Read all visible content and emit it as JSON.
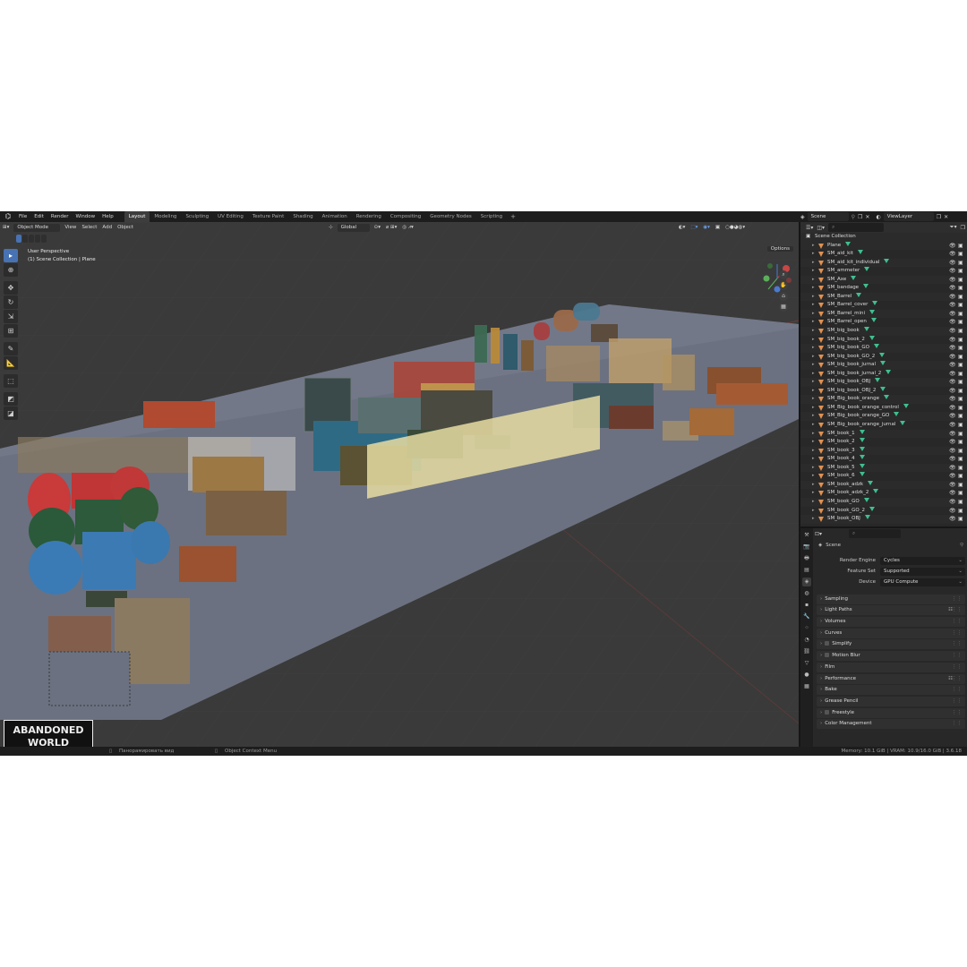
{
  "topbar": {
    "menus": [
      "File",
      "Edit",
      "Render",
      "Window",
      "Help"
    ],
    "workspaces": [
      "Layout",
      "Modeling",
      "Sculpting",
      "UV Editing",
      "Texture Paint",
      "Shading",
      "Animation",
      "Rendering",
      "Compositing",
      "Geometry Nodes",
      "Scripting"
    ],
    "active_workspace": "Layout",
    "scene": "Scene",
    "view_layer": "ViewLayer"
  },
  "viewport": {
    "mode": "Object Mode",
    "menus": [
      "View",
      "Select",
      "Add",
      "Object"
    ],
    "transform_orientation": "Global",
    "options_label": "Options",
    "info_line1": "User Perspective",
    "info_line2": "(1) Scene Collection | Plane",
    "gizmo_axes": [
      "X",
      "Y",
      "Z"
    ],
    "watermark_line1": "ABANDONED",
    "watermark_line2": "WORLD"
  },
  "outliner": {
    "collection": "Scene Collection",
    "items": [
      "Plane",
      "SM_aid_kit",
      "SM_aid_kit_individual",
      "SM_ammeter",
      "SM_Axe",
      "SM_bandage",
      "SM_Barrel",
      "SM_Barrel_cover",
      "SM_Barrel_mini",
      "SM_Barrel_open",
      "SM_big_book",
      "SM_big_book_2",
      "SM_big_book_GO",
      "SM_big_book_GO_2",
      "SM_big_book_jurnal",
      "SM_big_book_jurnal_2",
      "SM_big_book_OBJ",
      "SM_big_book_OBJ_2",
      "SM_Big_book_orange",
      "SM_Big_book_orange_control",
      "SM_Big_book_orange_GO",
      "SM_Big_book_orange_jurnal",
      "SM_book_1",
      "SM_book_2",
      "SM_book_3",
      "SM_book_4",
      "SM_book_5",
      "SM_book_6",
      "SM_book_adzk",
      "SM_book_adzk_2",
      "SM_book_GO",
      "SM_book_GO_2",
      "SM_book_OBJ"
    ]
  },
  "properties": {
    "context": "Scene",
    "render_engine_label": "Render Engine",
    "render_engine": "Cycles",
    "feature_set_label": "Feature Set",
    "feature_set": "Supported",
    "device_label": "Device",
    "device": "GPU Compute",
    "panels": [
      {
        "label": "Sampling",
        "checkbox": false,
        "list": false
      },
      {
        "label": "Light Paths",
        "checkbox": false,
        "list": true
      },
      {
        "label": "Volumes",
        "checkbox": false,
        "list": false
      },
      {
        "label": "Curves",
        "checkbox": false,
        "list": false
      },
      {
        "label": "Simplify",
        "checkbox": true,
        "list": false
      },
      {
        "label": "Motion Blur",
        "checkbox": true,
        "list": false
      },
      {
        "label": "Film",
        "checkbox": false,
        "list": false
      },
      {
        "label": "Performance",
        "checkbox": false,
        "list": true
      },
      {
        "label": "Bake",
        "checkbox": false,
        "list": false
      },
      {
        "label": "Grease Pencil",
        "checkbox": false,
        "list": false
      },
      {
        "label": "Freestyle",
        "checkbox": true,
        "list": false
      },
      {
        "label": "Color Management",
        "checkbox": false,
        "list": false
      }
    ]
  },
  "statusbar": {
    "hint1": "Панорамировать вид",
    "hint2": "Object Context Menu",
    "stats": "Memory: 10.1 GiB | VRAM: 10.9/16.0 GiB | 3.6.18"
  },
  "colors": {
    "accent": "#4772b3",
    "mesh_icon": "#3fbf8f",
    "object_icon": "#e09050",
    "viewport_bg": "#3a3a3a",
    "floor_plane": "#6b7180"
  }
}
